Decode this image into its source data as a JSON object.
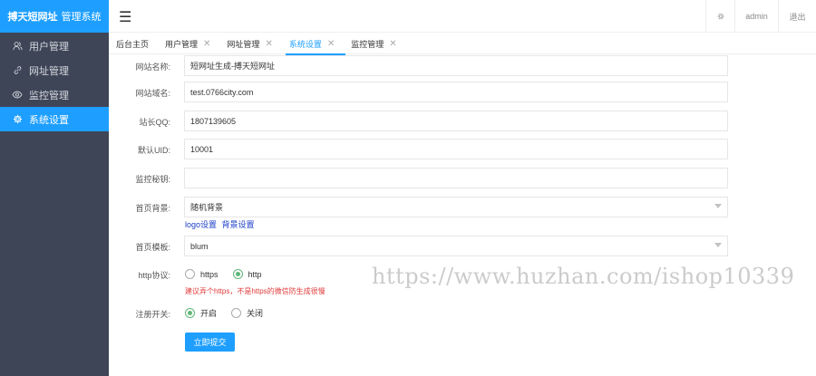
{
  "app": {
    "logo_main": "搏天短网址",
    "logo_sub": "管理系统"
  },
  "sidebar": {
    "items": [
      {
        "label": "用户管理",
        "icon": "user-icon"
      },
      {
        "label": "网址管理",
        "icon": "link-icon"
      },
      {
        "label": "监控管理",
        "icon": "eye-icon"
      },
      {
        "label": "系统设置",
        "icon": "gear-icon",
        "active": true
      }
    ]
  },
  "header": {
    "user": "admin",
    "logout": "退出"
  },
  "tabs": [
    {
      "label": "后台主页",
      "closable": false
    },
    {
      "label": "用户管理",
      "closable": true
    },
    {
      "label": "网址管理",
      "closable": true
    },
    {
      "label": "系统设置",
      "closable": true,
      "active": true
    },
    {
      "label": "监控管理",
      "closable": true
    }
  ],
  "form": {
    "site_name": {
      "label": "网站名称:",
      "value": "短网址生成-搏天短网址"
    },
    "site_domain": {
      "label": "网站域名:",
      "value": "test.0766city.com"
    },
    "admin_qq": {
      "label": "站长QQ:",
      "value": "1807139605"
    },
    "default_uid": {
      "label": "默认UID:",
      "value": "10001"
    },
    "monitor_key": {
      "label": "监控秘钥:",
      "value": ""
    },
    "home_bg": {
      "label": "首页背景:",
      "value": "随机背景",
      "link1": "logo设置",
      "link2": "背景设置"
    },
    "home_template": {
      "label": "首页模板:",
      "value": "blum"
    },
    "http_protocol": {
      "label": "http协议:",
      "opt1": "https",
      "opt2": "http",
      "selected": "http",
      "note": "建议弄个https，不是https的微信防生成很慢"
    },
    "register_switch": {
      "label": "注册开关:",
      "opt1": "开启",
      "opt2": "关闭",
      "selected": "开启"
    },
    "submit": "立即提交"
  },
  "watermark": "https://www.huzhan.com/ishop10339",
  "colors": {
    "accent": "#1e9fff",
    "sidebar": "#3e4557",
    "radio_on": "#5fb878",
    "note": "#e03a3a"
  }
}
